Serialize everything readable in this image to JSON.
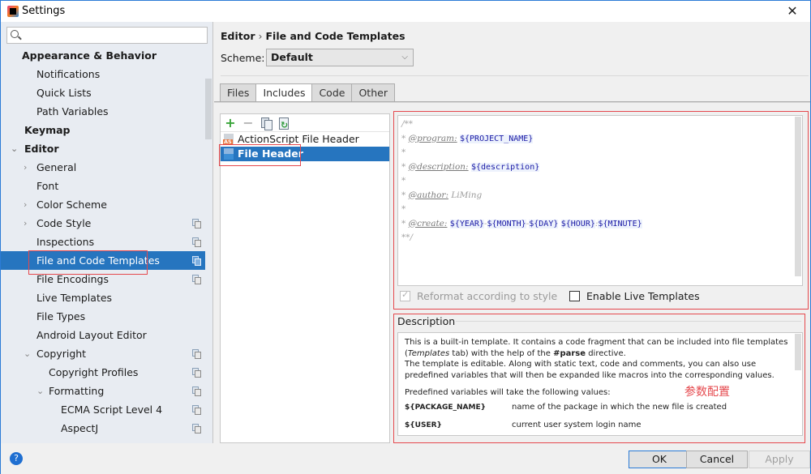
{
  "window": {
    "title": "Settings",
    "close_label": "✕"
  },
  "sidebar": {
    "search": {
      "value": "",
      "placeholder": ""
    },
    "items": [
      {
        "label": "Appearance & Behavior",
        "level": 0,
        "bold": true,
        "arrow": "",
        "copy": false
      },
      {
        "label": "Notifications",
        "level": 1,
        "bold": false,
        "arrow": "",
        "copy": false
      },
      {
        "label": "Quick Lists",
        "level": 1,
        "bold": false,
        "arrow": "",
        "copy": false
      },
      {
        "label": "Path Variables",
        "level": 1,
        "bold": false,
        "arrow": "",
        "copy": false
      },
      {
        "label": "Keymap",
        "level": 0,
        "bold": true,
        "arrow": "",
        "copy": false
      },
      {
        "label": "Editor",
        "level": 0,
        "bold": true,
        "arrow": "expanded",
        "copy": false
      },
      {
        "label": "General",
        "level": 1,
        "bold": false,
        "arrow": "collapsed",
        "copy": false
      },
      {
        "label": "Font",
        "level": 1,
        "bold": false,
        "arrow": "",
        "copy": false
      },
      {
        "label": "Color Scheme",
        "level": 1,
        "bold": false,
        "arrow": "collapsed",
        "copy": false
      },
      {
        "label": "Code Style",
        "level": 1,
        "bold": false,
        "arrow": "collapsed",
        "copy": true
      },
      {
        "label": "Inspections",
        "level": 1,
        "bold": false,
        "arrow": "",
        "copy": true
      },
      {
        "label": "File and Code Templates",
        "level": 1,
        "bold": false,
        "arrow": "",
        "copy": true,
        "selected": true
      },
      {
        "label": "File Encodings",
        "level": 1,
        "bold": false,
        "arrow": "",
        "copy": true
      },
      {
        "label": "Live Templates",
        "level": 1,
        "bold": false,
        "arrow": "",
        "copy": false
      },
      {
        "label": "File Types",
        "level": 1,
        "bold": false,
        "arrow": "",
        "copy": false
      },
      {
        "label": "Android Layout Editor",
        "level": 1,
        "bold": false,
        "arrow": "",
        "copy": false
      },
      {
        "label": "Copyright",
        "level": 1,
        "bold": false,
        "arrow": "expanded",
        "copy": true
      },
      {
        "label": "Copyright Profiles",
        "level": 2,
        "bold": false,
        "arrow": "",
        "copy": true
      },
      {
        "label": "Formatting",
        "level": 2,
        "bold": false,
        "arrow": "expanded",
        "copy": true
      },
      {
        "label": "ECMA Script Level 4",
        "level": 3,
        "bold": false,
        "arrow": "",
        "copy": true
      },
      {
        "label": "AspectJ",
        "level": 3,
        "bold": false,
        "arrow": "",
        "copy": true
      }
    ]
  },
  "main": {
    "breadcrumb": {
      "parent": "Editor",
      "separator": "›",
      "current": "File and Code Templates"
    },
    "scheme": {
      "label": "Scheme:",
      "value": "Default"
    },
    "tabs": [
      {
        "label": "Files",
        "active": false
      },
      {
        "label": "Includes",
        "active": true
      },
      {
        "label": "Code",
        "active": false
      },
      {
        "label": "Other",
        "active": false
      }
    ],
    "templates": [
      {
        "label": "ActionScript File Header",
        "icon": "actionscript-file-icon",
        "selected": false
      },
      {
        "label": "File Header",
        "icon": "file-header-icon",
        "selected": true
      }
    ],
    "code_lines": [
      [
        {
          "t": "/**",
          "c": "cm"
        }
      ],
      [
        {
          "t": "* ",
          "c": "cm"
        },
        {
          "t": "@program:",
          "c": "tag"
        },
        {
          "t": " ",
          "c": ""
        },
        {
          "t": "${PROJECT_NAME}",
          "c": "var"
        }
      ],
      [
        {
          "t": "*",
          "c": "cm"
        }
      ],
      [
        {
          "t": "* ",
          "c": "cm"
        },
        {
          "t": "@description:",
          "c": "tag"
        },
        {
          "t": " ",
          "c": ""
        },
        {
          "t": "${description}",
          "c": "var"
        }
      ],
      [
        {
          "t": "*",
          "c": "cm"
        }
      ],
      [
        {
          "t": "* ",
          "c": "cm"
        },
        {
          "t": "@author:",
          "c": "tag"
        },
        {
          "t": " LiMing",
          "c": "val"
        }
      ],
      [
        {
          "t": "*",
          "c": "cm"
        }
      ],
      [
        {
          "t": "* ",
          "c": "cm"
        },
        {
          "t": "@create:",
          "c": "tag"
        },
        {
          "t": " ",
          "c": ""
        },
        {
          "t": "${YEAR}",
          "c": "var"
        },
        {
          "t": "-",
          "c": "cm"
        },
        {
          "t": "${MONTH}",
          "c": "var"
        },
        {
          "t": "-",
          "c": "cm"
        },
        {
          "t": "${DAY}",
          "c": "var"
        },
        {
          "t": " ",
          "c": ""
        },
        {
          "t": "${HOUR}",
          "c": "var"
        },
        {
          "t": ":",
          "c": "cm"
        },
        {
          "t": "${MINUTE}",
          "c": "var"
        }
      ],
      [
        {
          "t": "**/",
          "c": "cm"
        }
      ]
    ],
    "reformat": {
      "label": "Reformat according to style",
      "checked": true,
      "disabled": true
    },
    "live_templates": {
      "label": "Enable Live Templates",
      "checked": false
    },
    "description": {
      "title": "Description",
      "para1": "This is a built-in template. It contains a code fragment that can be included into file templates",
      "para1b_pre": "(",
      "para1b_italic": "Templates",
      "para1b_mid": " tab) with the help of the ",
      "para1b_bold": "#parse",
      "para1b_post": " directive.",
      "para2": "The template is editable. Along with static text, code and comments, you can also use",
      "para2b": "predefined variables that will then be expanded like macros into the corresponding values.",
      "para3": "Predefined variables will take the following values:",
      "variables": [
        {
          "name": "${PACKAGE_NAME}",
          "desc": "name of the package in which the new file is created"
        },
        {
          "name": "${USER}",
          "desc": "current user system login name"
        }
      ]
    },
    "annotation": "参数配置"
  },
  "footer": {
    "help": "?",
    "ok": "OK",
    "cancel": "Cancel",
    "apply": "Apply"
  },
  "colors": {
    "accent": "#2675bf",
    "highlight_box": "#e5484d",
    "variable": "#1a1aa6"
  }
}
